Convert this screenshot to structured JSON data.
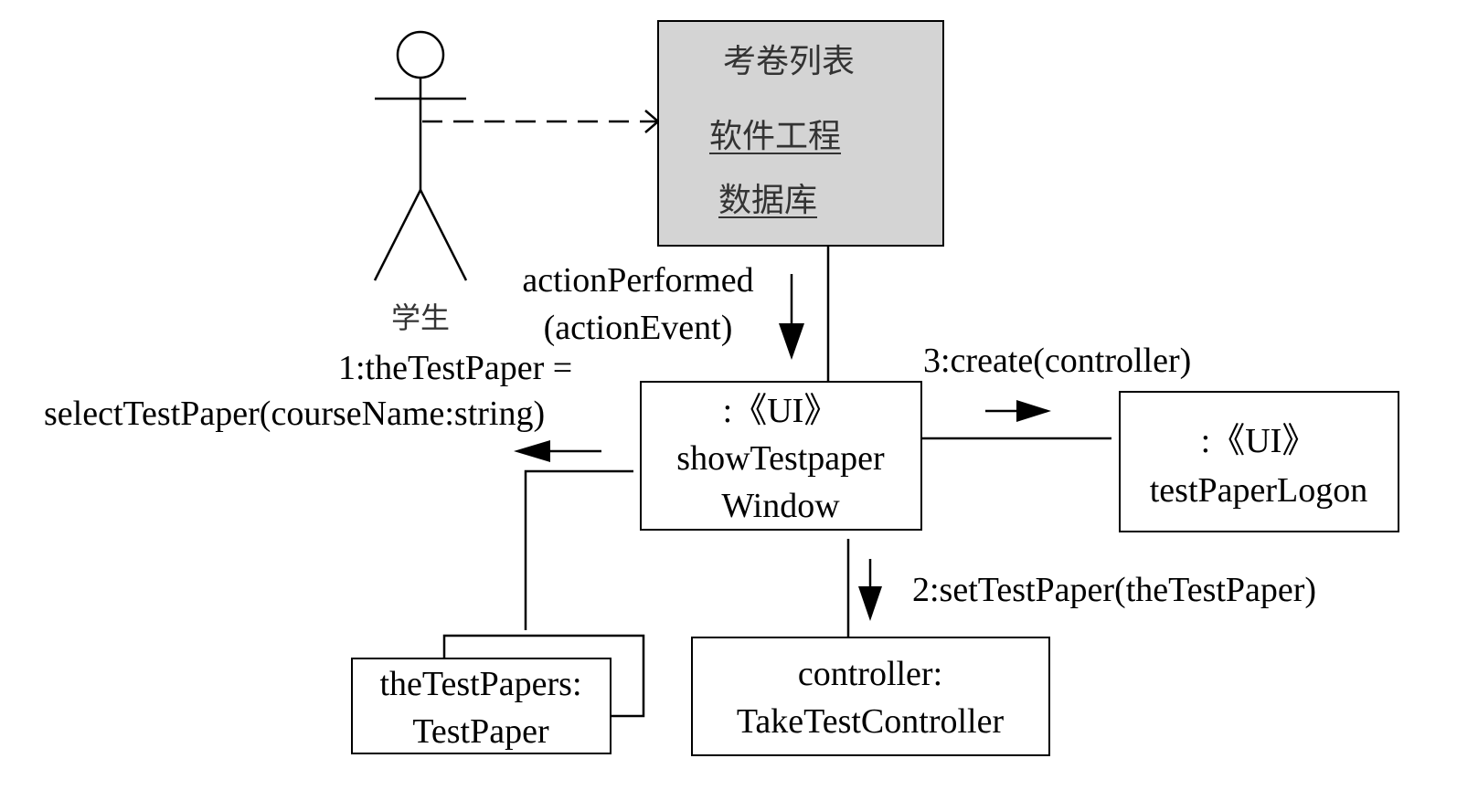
{
  "actor": {
    "name": "学生"
  },
  "screen": {
    "title": "考卷列表",
    "items": [
      "软件工程",
      "数据库"
    ],
    "fill": "#d4d4d4"
  },
  "objects": {
    "show_window": {
      "line1": ":《UI》",
      "line2": "showTestpaper",
      "line3": "Window"
    },
    "logon": {
      "line1": ":《UI》",
      "line2": "testPaperLogon"
    },
    "test_papers": {
      "line1": "theTestPapers:",
      "line2": "TestPaper"
    },
    "controller": {
      "line1": "controller:",
      "line2": "TakeTestController"
    }
  },
  "messages": {
    "action_performed": {
      "line1": "actionPerformed",
      "line2": "(actionEvent)"
    },
    "select": {
      "line1": "1:theTestPaper =",
      "line2": "selectTestPaper(courseName:string)"
    },
    "create": "3:create(controller)",
    "set": "2:setTestPaper(theTestPaper)"
  }
}
